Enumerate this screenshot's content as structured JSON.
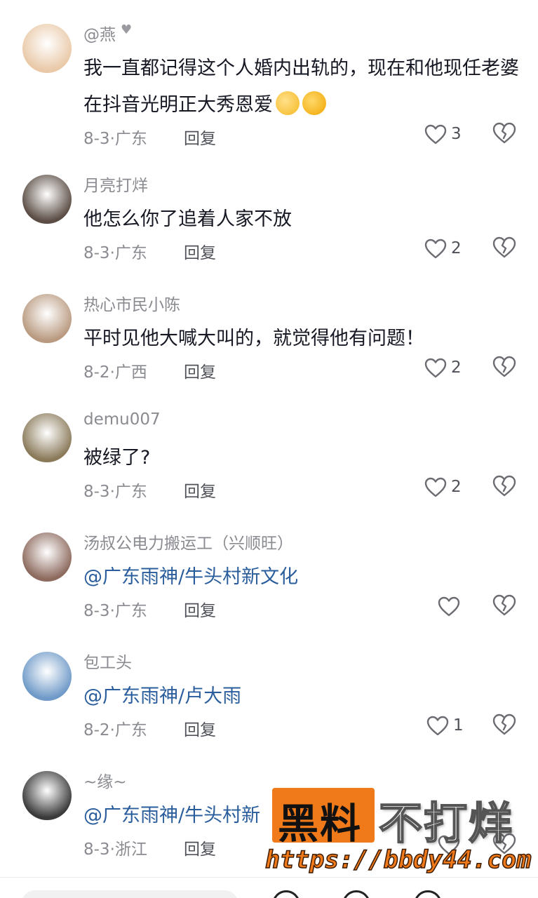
{
  "comments": [
    {
      "username": "@燕",
      "has_heart": true,
      "text": "我一直都记得这个人婚内出轨的，现在和他现任老婆在抖音光明正大秀恩爱",
      "emojis": [
        "kiss-face-emoji",
        "laughing-crying-emoji"
      ],
      "is_mention": false,
      "date_location": "8-3·广东",
      "reply_label": "回复",
      "likes": "3",
      "avatar_color": "#e9c9a8"
    },
    {
      "username": "月亮打烊",
      "has_heart": false,
      "text": "他怎么你了追着人家不放",
      "emojis": [],
      "is_mention": false,
      "date_location": "8-3·广东",
      "reply_label": "回复",
      "likes": "2",
      "avatar_color": "#5b4d45"
    },
    {
      "username": "热心市民小陈",
      "has_heart": false,
      "text": "平时见他大喊大叫的，就觉得他有问题！",
      "emojis": [],
      "is_mention": false,
      "date_location": "8-2·广西",
      "reply_label": "回复",
      "likes": "2",
      "avatar_color": "#b99a80"
    },
    {
      "username": "demu007",
      "has_heart": false,
      "text": "被绿了?",
      "emojis": [],
      "is_mention": false,
      "date_location": "8-3·广东",
      "reply_label": "回复",
      "likes": "2",
      "avatar_color": "#8a7a5a"
    },
    {
      "username": "汤叔公电力搬运工（兴顺旺）",
      "has_heart": false,
      "text": "@广东雨神/牛头村新文化",
      "emojis": [],
      "is_mention": true,
      "date_location": "8-3·广东",
      "reply_label": "回复",
      "likes": "",
      "avatar_color": "#8d6a5e"
    },
    {
      "username": "包工头",
      "has_heart": false,
      "text": "@广东雨神/卢大雨",
      "emojis": [],
      "is_mention": true,
      "date_location": "8-2·广东",
      "reply_label": "回复",
      "likes": "1",
      "avatar_color": "#6f9ac8"
    },
    {
      "username": "~缘~",
      "has_heart": false,
      "text": "@广东雨神/牛头村新",
      "emojis": [],
      "is_mention": true,
      "date_location": "8-3·浙江",
      "reply_label": "回复",
      "likes": "",
      "avatar_color": "#3a3a3a"
    }
  ],
  "watermark": {
    "box_text": "黑料",
    "main_text": "不打烊",
    "url": "https://bbdy44.com"
  },
  "icons": {
    "like": "heart-outline-icon",
    "dislike": "broken-heart-icon"
  },
  "colors": {
    "mention": "#2a5d9c",
    "meta": "#8a8b91",
    "watermark_orange": "#f07a1a"
  }
}
